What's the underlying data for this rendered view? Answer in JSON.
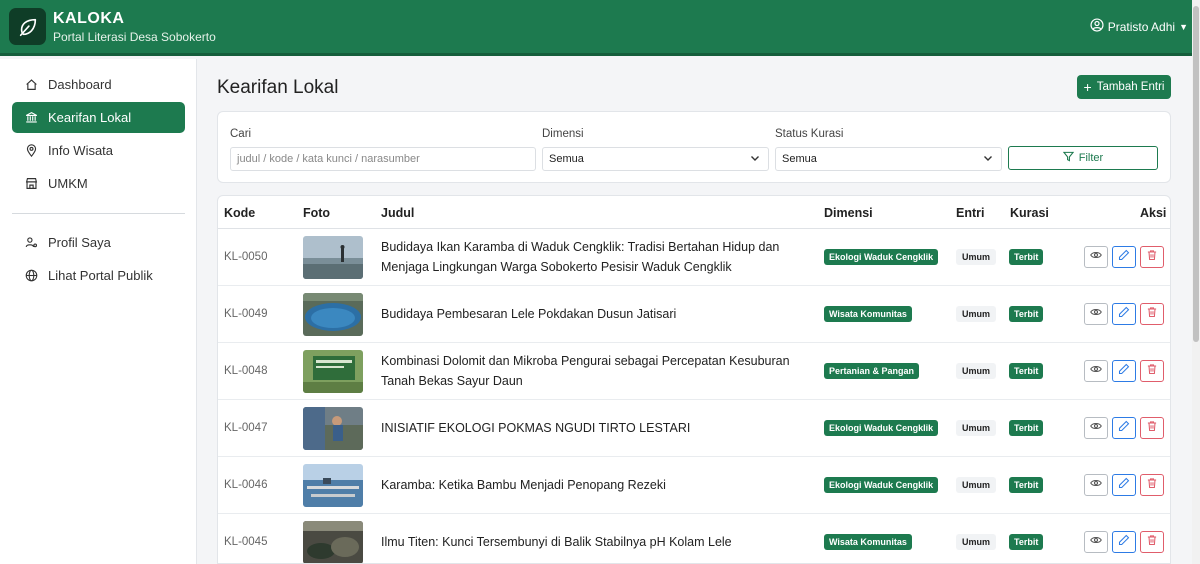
{
  "header": {
    "brand_title": "KALOKA",
    "brand_subtitle": "Portal Literasi Desa Sobokerto",
    "user_name": "Pratisto Adhi",
    "accent_color": "#1d7a4f"
  },
  "sidebar": {
    "items": [
      {
        "label": "Dashboard",
        "icon": "home-icon",
        "active": false
      },
      {
        "label": "Kearifan Lokal",
        "icon": "institution-icon",
        "active": true
      },
      {
        "label": "Info Wisata",
        "icon": "map-pin-icon",
        "active": false
      },
      {
        "label": "UMKM",
        "icon": "shop-icon",
        "active": false
      },
      {
        "label": "Profil Saya",
        "icon": "user-gear-icon",
        "active": false
      },
      {
        "label": "Lihat Portal Publik",
        "icon": "globe-icon",
        "active": false
      }
    ]
  },
  "main": {
    "title": "Kearifan Lokal",
    "add_button_label": "Tambah Entri",
    "filters": {
      "search_label": "Cari",
      "search_placeholder": "judul / kode / kata kunci / narasumber",
      "dimensi_label": "Dimensi",
      "dimensi_value": "Semua",
      "status_label": "Status Kurasi",
      "status_value": "Semua",
      "filter_button_label": "Filter"
    },
    "table": {
      "columns": [
        "Kode",
        "Foto",
        "Judul",
        "Dimensi",
        "Entri",
        "Kurasi",
        "Aksi"
      ],
      "rows": [
        {
          "kode": "KL-0050",
          "judul": "Budidaya Ikan Karamba di Waduk Cengklik: Tradisi Bertahan Hidup dan Menjaga Lingkungan Warga Sobokerto Pesisir Waduk Cengklik",
          "dimensi": "Ekologi Waduk Cengklik",
          "entri": "Umum",
          "kurasi": "Terbit"
        },
        {
          "kode": "KL-0049",
          "judul": "Budidaya Pembesaran Lele Pokdakan Dusun Jatisari",
          "dimensi": "Wisata Komunitas",
          "entri": "Umum",
          "kurasi": "Terbit"
        },
        {
          "kode": "KL-0048",
          "judul": "Kombinasi Dolomit dan Mikroba Pengurai sebagai Percepatan Kesuburan Tanah Bekas Sayur Daun",
          "dimensi": "Pertanian & Pangan",
          "entri": "Umum",
          "kurasi": "Terbit"
        },
        {
          "kode": "KL-0047",
          "judul": "INISIATIF EKOLOGI POKMAS NGUDI TIRTO LESTARI",
          "dimensi": "Ekologi Waduk Cengklik",
          "entri": "Umum",
          "kurasi": "Terbit"
        },
        {
          "kode": "KL-0046",
          "judul": "Karamba: Ketika Bambu Menjadi Penopang Rezeki",
          "dimensi": "Ekologi Waduk Cengklik",
          "entri": "Umum",
          "kurasi": "Terbit"
        },
        {
          "kode": "KL-0045",
          "judul": "Ilmu Titen: Kunci Tersembunyi di Balik Stabilnya pH Kolam Lele",
          "dimensi": "Wisata Komunitas",
          "entri": "Umum",
          "kurasi": "Terbit"
        }
      ]
    }
  }
}
